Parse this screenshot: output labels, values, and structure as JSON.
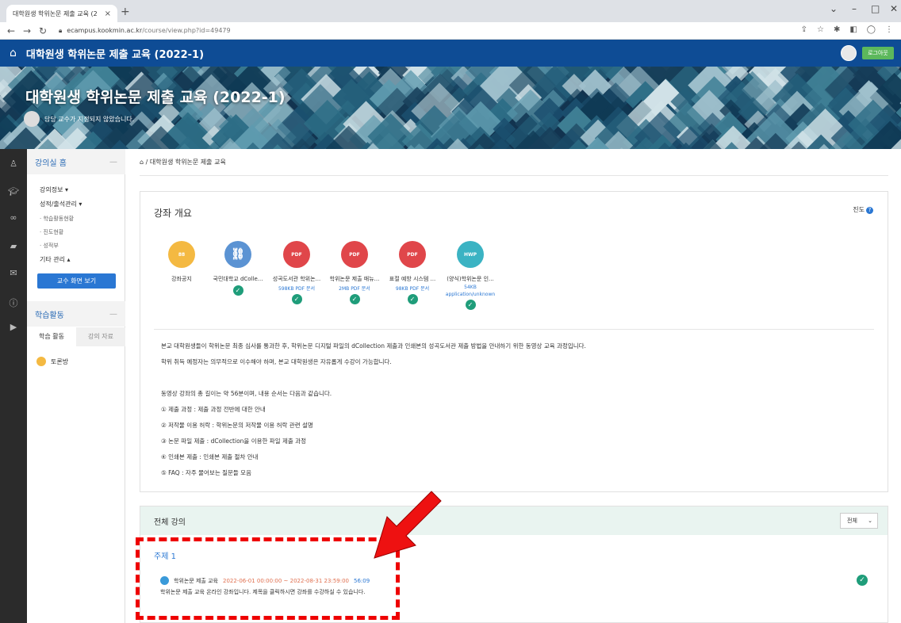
{
  "browser": {
    "tab_title": "대학원생 학위논문 제출 교육 (2",
    "url_host": "ecampus.kookmin.ac.kr",
    "url_path": "/course/view.php?id=49479"
  },
  "topnav": {
    "title": "대학원생 학위논문 제출 교육 (2022-1)",
    "logout": "로그아웃"
  },
  "banner": {
    "title": "대학원생 학위논문 제출 교육 (2022-1)",
    "professor": "담당 교수가 지정되지 않았습니다."
  },
  "sidebar": {
    "home": "강의실 홈",
    "course_info": "강의정보 ▾",
    "grades": "성적/출석관리 ▾",
    "sub_items": [
      "· 학습활동현황",
      "· 진도현황",
      "· 성적부"
    ],
    "other": "기타 관리 ▴",
    "professor_view": "교수 화면 보기",
    "activities": "학습활동",
    "tab_activity": "학습 활동",
    "tab_material": "강의 자료",
    "forum": "토론방"
  },
  "breadcrumb": {
    "home_icon": "home-icon",
    "course": "대학원생 학위논문 제출 교육"
  },
  "overview": {
    "title": "강좌 개요",
    "progress": "진도",
    "resources": [
      {
        "name": "강좌공지",
        "meta": "",
        "color": "#f4b942",
        "icon": "people-icon",
        "done": false
      },
      {
        "name": "국민대학교 dColle...",
        "meta": "",
        "color": "#5b93d3",
        "icon": "link-icon",
        "done": true
      },
      {
        "name": "성곡도서관 학위논...",
        "meta": "598KB PDF 문서",
        "color": "#e0464a",
        "icon": "pdf-icon",
        "done": true
      },
      {
        "name": "학위논문 제출 매뉴...",
        "meta": "2MB PDF 문서",
        "color": "#e0464a",
        "icon": "pdf-icon",
        "done": true
      },
      {
        "name": "표절 예방 시스템 ...",
        "meta": "98KB PDF 문서",
        "color": "#e0464a",
        "icon": "pdf-icon",
        "done": true
      },
      {
        "name": "(양식)학위논문 인...",
        "meta": "54KB",
        "meta2": "application/unknown",
        "color": "#3bb3c3",
        "icon": "hwp-icon",
        "done": true
      }
    ],
    "paragraphs": [
      "본교 대학원생들이 학위논문 최종 심사를 통과한 후, 학위논문 디지털 파일의 dCollection 제출과 인쇄본의 성곡도서관 제출 방법을 안내하기 위한 동영상 교육 과정입니다.",
      "학위 취득 예정자는 의무적으로 이수해야 하며, 본교 대학원생은 자유롭게 수강이 가능합니다.",
      "동영상 강좌의 총 길이는 약 56분이며, 내용 순서는 다음과 같습니다.",
      "① 제출 과정 : 제출 과정 전반에 대한 안내",
      "② 저작물 이용 허락 : 학위논문의 저작물 이용 허락 관련 설명",
      "③ 논문 파일 제출 : dCollection을 이용한 파일 제출 과정",
      "④ 인쇄본 제출 : 인쇄본 제출 절차 안내",
      "⑤ FAQ : 자주 물어보는 질문들 모음"
    ]
  },
  "lectures": {
    "title": "전체 강의",
    "filter": "전체",
    "topic": "주제 1",
    "activity_name": "학위논문 제출 교육",
    "activity_dates": "2022-06-01 00:00:00 ~ 2022-08-31 23:59:00",
    "activity_duration": "56:09",
    "activity_desc": "학위논문 제출 교육 온라인 강좌입니다. 제목을 클릭하시면 강좌를 수강하실 수 있습니다."
  },
  "colors": {
    "nav": "#0e4c95",
    "accent": "#2a77d3",
    "check": "#1f9d7a",
    "annotation": "#ee0000"
  }
}
